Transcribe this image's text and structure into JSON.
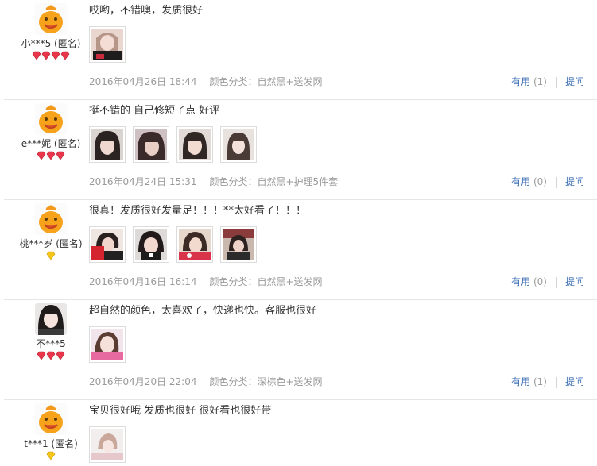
{
  "labels": {
    "useful": "有用",
    "ask": "提问"
  },
  "reviews": [
    {
      "username": "小***5 (匿名)",
      "avatar": "mascot",
      "badge": "red-4",
      "text": "哎哟，不错噢，发质很好",
      "photos": 1,
      "date": "2016年04月26日 18:44",
      "sku": "颜色分类：自然黑+送发网",
      "useful_count": "(1)"
    },
    {
      "username": "e***妮 (匿名)",
      "avatar": "mascot",
      "badge": "red-3",
      "text": "挺不错的 自己修短了点 好评",
      "photos": 4,
      "date": "2016年04月24日 15:31",
      "sku": "颜色分类：自然黑+护理5件套",
      "useful_count": "(0)"
    },
    {
      "username": "桃***岁 (匿名)",
      "avatar": "mascot",
      "badge": "yellow-1",
      "text": "很真！发质很好发量足！！！**太好看了！！！",
      "photos": 4,
      "date": "2016年04月16日 16:14",
      "sku": "颜色分类：自然黑+送发网",
      "useful_count": "(0)"
    },
    {
      "username": "不***5",
      "avatar": "photo",
      "badge": "red-3",
      "text": "超自然的颜色，太喜欢了，快递也快。客服也很好",
      "photos": 1,
      "date": "2016年04月20日 22:04",
      "sku": "颜色分类：深棕色+送发网",
      "useful_count": "(1)"
    },
    {
      "username": "t***1 (匿名)",
      "avatar": "mascot",
      "badge": "yellow-1",
      "text": "宝贝很好哦 发质也很好 很好看也很好带",
      "photos": 1
    }
  ]
}
